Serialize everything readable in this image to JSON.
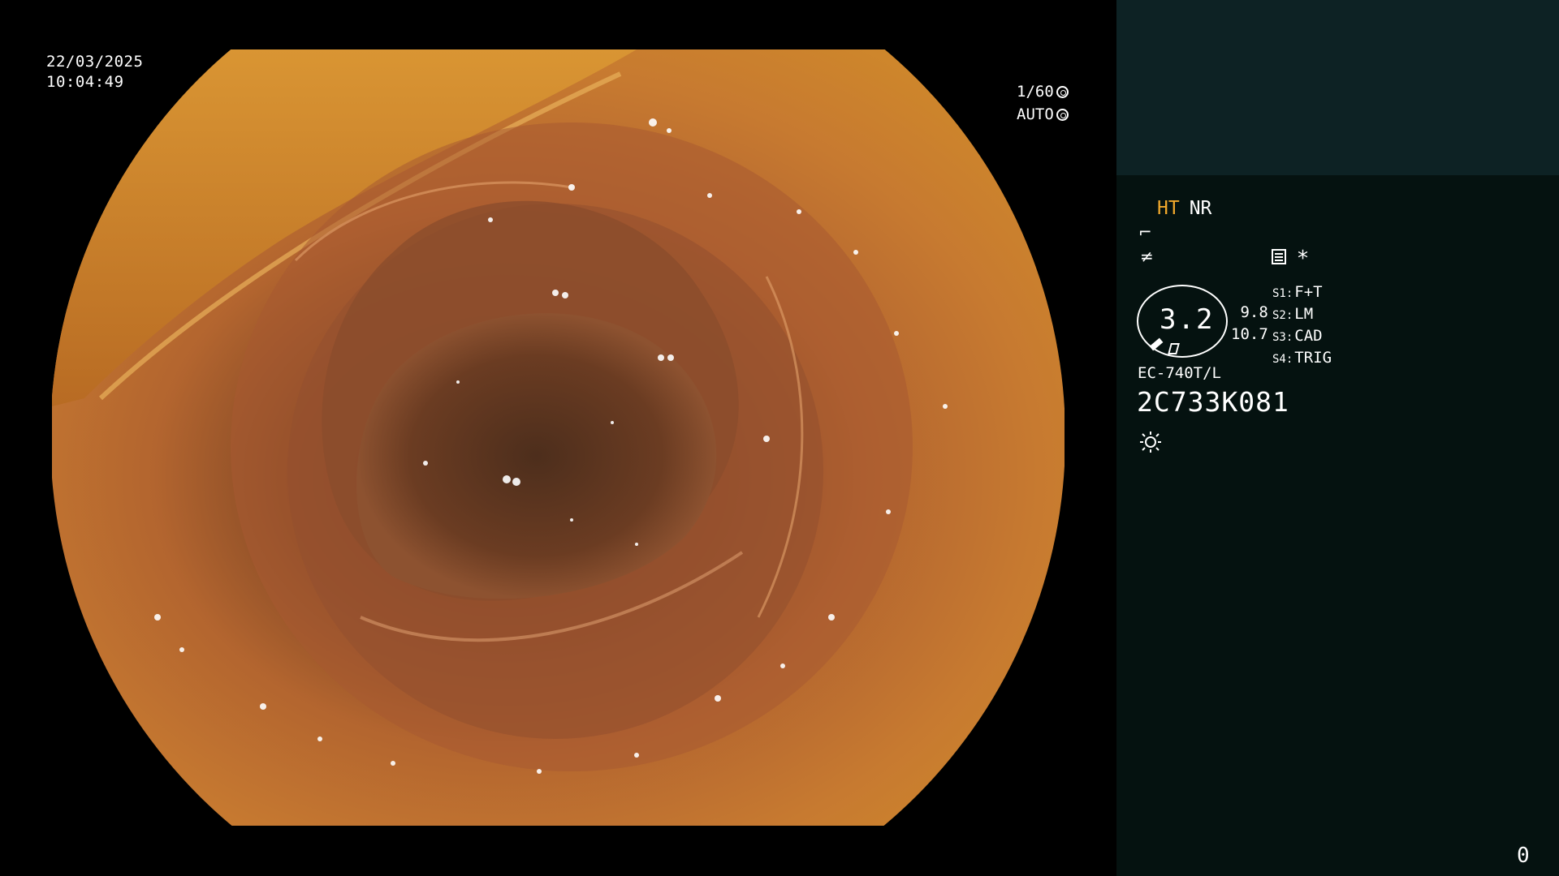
{
  "video": {
    "date": "22/03/2025",
    "time": "10:04:49",
    "shutter": "1/60",
    "iris": "AUTO",
    "image_alt": "Endoscopic view of colon lumen"
  },
  "panel": {
    "mode_ht": "HT",
    "mode_nr": "NR",
    "enhancement_value": "3.2",
    "side_value_1": "9.8",
    "side_value_2": "10.7",
    "switches": [
      {
        "key": "S1:",
        "value": "F+T"
      },
      {
        "key": "S2:",
        "value": "LM"
      },
      {
        "key": "S3:",
        "value": "CAD"
      },
      {
        "key": "S4:",
        "value": "TRIG"
      }
    ],
    "scope_model": "EC-740T/L",
    "scope_serial": "2C733K081",
    "asterisk": "*",
    "wave_symbol": "⌐",
    "func_symbol": "≠"
  },
  "footer": {
    "count": "0"
  },
  "colors": {
    "panel_bg": "#051210",
    "panel_top_bg": "#0d2224",
    "ht_color": "#f2a92c"
  }
}
